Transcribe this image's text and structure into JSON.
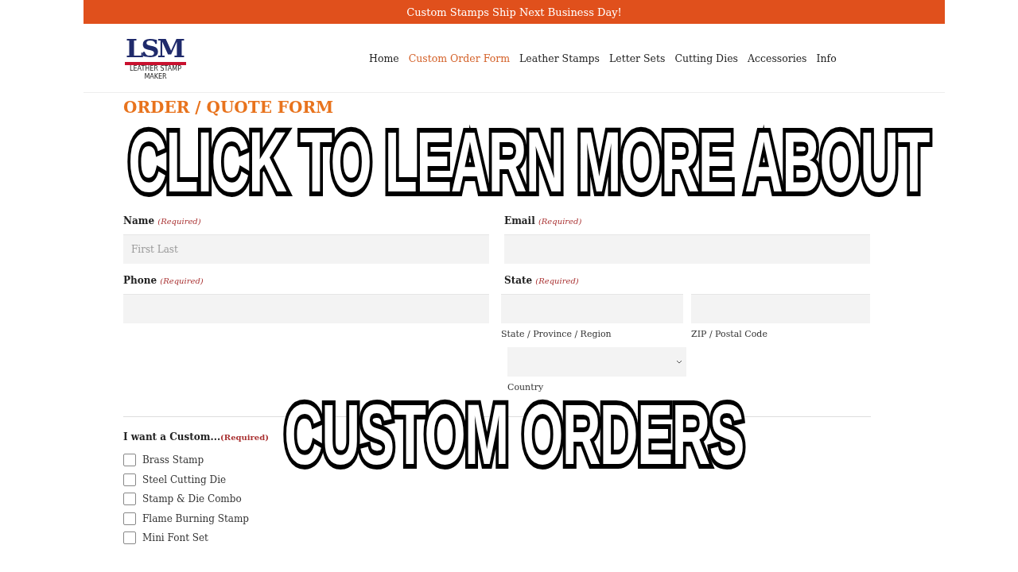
{
  "announcement": "Custom Stamps Ship Next Business Day!",
  "logo": {
    "letters": "LSM",
    "tagline": "LEATHER STAMP",
    "subtagline": "MAKER"
  },
  "nav": [
    {
      "label": "Home",
      "selected": false
    },
    {
      "label": "Custom Order Form",
      "selected": true
    },
    {
      "label": "Leather Stamps",
      "selected": false
    },
    {
      "label": "Letter Sets",
      "selected": false
    },
    {
      "label": "Cutting Dies",
      "selected": false
    },
    {
      "label": "Accessories",
      "selected": false
    },
    {
      "label": "Info",
      "selected": false
    }
  ],
  "form": {
    "title": "ORDER / QUOTE FORM",
    "name": {
      "label": "Name",
      "required": "(Required)",
      "placeholder": "First Last"
    },
    "email": {
      "label": "Email",
      "required": "(Required)"
    },
    "phone": {
      "label": "Phone",
      "required": "(Required)"
    },
    "state": {
      "label": "State",
      "required": "(Required)",
      "region_label": "State / Province / Region",
      "zip_label": "ZIP / Postal Code",
      "country_label": "Country"
    },
    "custom": {
      "label": "I want a Custom...",
      "required": "(Required)",
      "options": [
        {
          "label": "Brass Stamp",
          "checked": false
        },
        {
          "label": "Steel Cutting Die",
          "checked": false
        },
        {
          "label": "Stamp & Die Combo",
          "checked": false
        },
        {
          "label": "Flame Burning Stamp",
          "checked": false
        },
        {
          "label": "Mini Font Set",
          "checked": false
        }
      ]
    }
  },
  "overlay": {
    "line_1": "CLICK TO LEARN MORE ABOUT",
    "line_2": "CUSTOM ORDERS"
  }
}
